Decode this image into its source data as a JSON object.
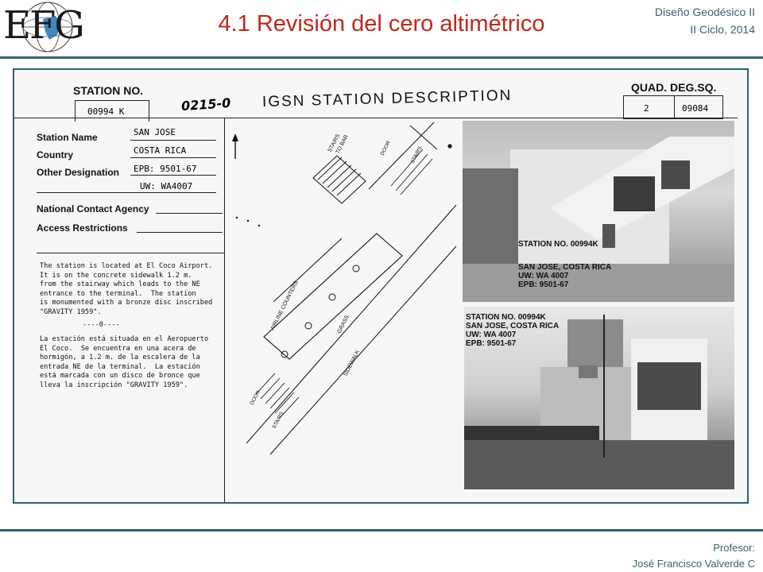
{
  "header": {
    "title": "4.1 Revisión del cero altimétrico",
    "course_line1": "Diseño Geodésico II",
    "course_line2": "II Ciclo, 2014",
    "logo_text": "EFG"
  },
  "footer": {
    "line1": "Profesor:",
    "line2": "José Francisco Valverde C"
  },
  "sheet": {
    "station_no_label": "STATION NO.",
    "station_no_value": "00994 K",
    "handwritten_code": "0215-0",
    "sheet_title": "IGSN STATION DESCRIPTION",
    "quad_label": "QUAD. DEG.SQ.",
    "quad_value": "2",
    "deg_value": "09084",
    "fields": [
      {
        "label": "Station Name",
        "value": "SAN JOSE"
      },
      {
        "label": "Country",
        "value": "COSTA RICA"
      },
      {
        "label": "Other Designation",
        "value": "EPB: 9501-67"
      },
      {
        "label": "",
        "value": "UW: WA4007"
      },
      {
        "label": "National Contact Agency",
        "value": ""
      },
      {
        "label": "Access Restrictions",
        "value": ""
      }
    ],
    "description_en": [
      "The station is located at El Coco Airport.",
      "It is on the concrete sidewalk 1.2 m.",
      "from the stairway which leads to the NE",
      "entrance to the terminal.  The station",
      "is monumented with a bronze disc inscribed",
      "\"GRAVITY 1959\"."
    ],
    "separator": "----0----",
    "description_es": [
      "La estación está situada en el Aeropuerto",
      "El Coco.  Se encuentra en una acera de",
      "hormigón, a 1.2 m. de la escalera de la",
      "entrada NE de la terminal.  La estación",
      "está marcada con un disco de bronce que",
      "lleva la inscripción \"GRAVITY 1959\"."
    ],
    "sketch": {
      "north": "N",
      "stairs_to_bar": [
        "STAIRS",
        "TO BAR"
      ],
      "door_top": "DOOR",
      "stairs_top": "STAIRS",
      "airline_counters": "AIRLINE COUNTERS",
      "grass": "GRASS",
      "sidewalk": "SIDEWALK",
      "door_bottom": "DOOR",
      "stairs_bottom": "STAIRS"
    },
    "photo_top_caption": [
      "STATION NO. 00994K",
      "SAN JOSE, COSTA RICA",
      "UW: WA 4007",
      "EPB: 9501-67"
    ],
    "photo_bottom_caption": [
      "STATION NO. 00994K",
      "SAN JOSE, COSTA RICA",
      "UW: WA 4007",
      "EPB: 9501-67"
    ]
  }
}
